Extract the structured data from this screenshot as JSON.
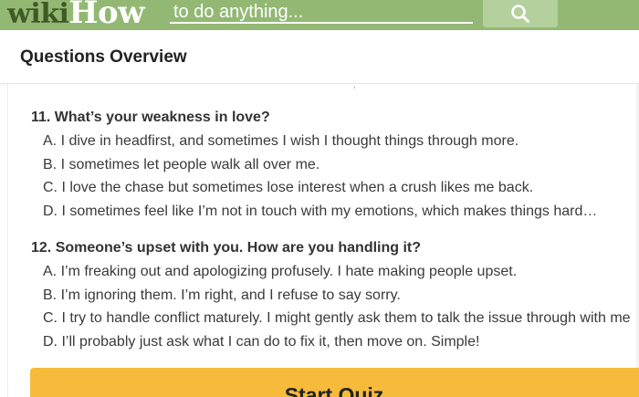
{
  "header": {
    "logo_part1": "wiki",
    "logo_part2": "How",
    "search_placeholder": "to do anything...",
    "search_icon": "magnifier-icon",
    "colors": {
      "bar": "#93b874",
      "logo_dark": "#3e5a25",
      "button": "#b4d09c"
    }
  },
  "overview": {
    "title": "Questions Overview"
  },
  "questions": [
    {
      "text": "11. What’s your weakness in love?",
      "options": [
        "A. I dive in headfirst, and sometimes I wish I thought things through more.",
        "B. I sometimes let people walk all over me.",
        "C. I love the chase but sometimes lose interest when a crush likes me back.",
        "D. I sometimes feel like I’m not in touch with my emotions, which makes things hard…"
      ]
    },
    {
      "text": "12. Someone’s upset with you. How are you handling it?",
      "options": [
        "A. I’m freaking out and apologizing profusely. I hate making people upset.",
        "B. I’m ignoring them. I’m right, and I refuse to say sorry.",
        "C. I try to handle conflict maturely. I might gently ask them to talk the issue through with me",
        "D. I’ll probably just ask what I can do to fix it, then move on. Simple!"
      ]
    }
  ],
  "start_button": {
    "label": "Start Quiz",
    "color": "#f6bb3a"
  }
}
